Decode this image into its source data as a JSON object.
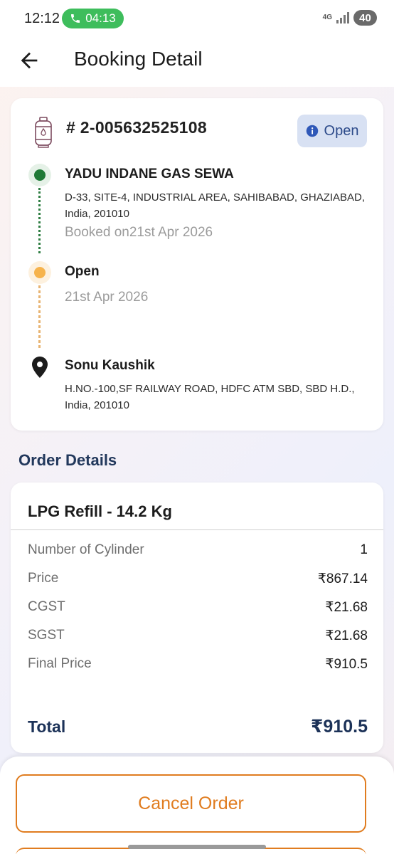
{
  "status_bar": {
    "time": "12:12",
    "call_timer": "04:13",
    "network": "4G",
    "battery": "40"
  },
  "header": {
    "title": "Booking Detail"
  },
  "booking": {
    "id": "# 2-005632525108",
    "status": "Open",
    "timeline": {
      "distributor_name": "YADU INDANE GAS SEWA",
      "distributor_address": "D-33, SITE-4, INDUSTRIAL AREA, SAHIBABAD, GHAZIABAD, India, 201010",
      "booked_on": "Booked on21st Apr 2026",
      "status_title": "Open",
      "status_date": "21st Apr 2026",
      "customer_name": "Sonu Kaushik",
      "customer_address": "H.NO.-100,SF RAILWAY ROAD, HDFC ATM SBD, SBD H.D., India, 201010"
    }
  },
  "order": {
    "section_title": "Order Details",
    "product": "LPG Refill - 14.2 Kg",
    "rows": [
      {
        "label": "Number of Cylinder",
        "value": "1"
      },
      {
        "label": "Price",
        "value": "₹867.14"
      },
      {
        "label": "CGST",
        "value": "₹21.68"
      },
      {
        "label": "SGST",
        "value": "₹21.68"
      },
      {
        "label": "Final Price",
        "value": "₹910.5"
      }
    ],
    "total_label": "Total",
    "total_value": "₹910.5"
  },
  "actions": {
    "cancel_label": "Cancel Order"
  },
  "colors": {
    "accent_orange": "#e07c1f",
    "navy": "#1c3258",
    "status_green": "#207a37",
    "status_yellow": "#f6b34c"
  }
}
